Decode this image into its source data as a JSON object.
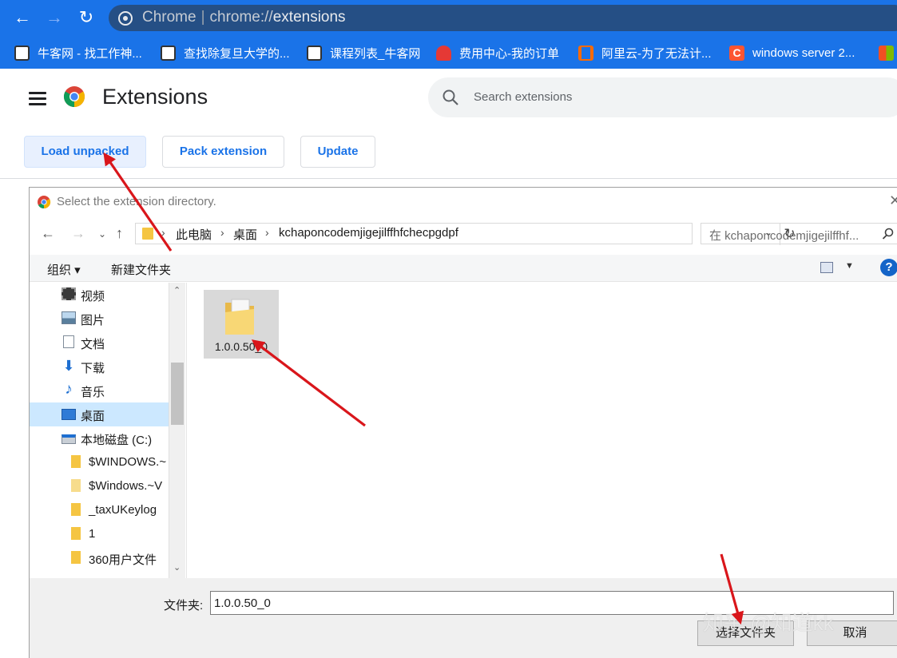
{
  "browser": {
    "omnibox_site": "Chrome",
    "omnibox_separator": "|",
    "omnibox_url_scheme": "chrome://",
    "omnibox_url_host": "extensions",
    "back_glyph": "←",
    "forward_glyph": "→",
    "reload_glyph": "↻"
  },
  "bookmarks": [
    {
      "label": "牛客网 - 找工作神...",
      "icon": "nowcoder-icon",
      "color": "#ffffff"
    },
    {
      "label": "查找除复旦大学的...",
      "icon": "nowcoder-icon",
      "color": "#ffffff"
    },
    {
      "label": "课程列表_牛客网",
      "icon": "nowcoder-icon",
      "color": "#ffffff"
    },
    {
      "label": "费用中心-我的订单",
      "icon": "huawei-icon",
      "color": "#e53935"
    },
    {
      "label": "阿里云-为了无法计...",
      "icon": "aliyun-icon",
      "color": "#ff6a00"
    },
    {
      "label": "windows server 2...",
      "icon": "csdn-icon",
      "color": "#fc5531"
    }
  ],
  "extensions_page": {
    "title": "Extensions",
    "search_placeholder": "Search extensions",
    "buttons": {
      "load_unpacked": "Load unpacked",
      "pack_extension": "Pack extension",
      "update": "Update"
    }
  },
  "dialog": {
    "title": "Select the extension directory.",
    "close_glyph": "✕",
    "breadcrumb": [
      "此电脑",
      "桌面",
      "kchaponcodemjigejilffhfchecpgdpf"
    ],
    "search_placeholder": "在 kchaponcodemjigejilffhf...",
    "commands": {
      "organize": "组织 ▾",
      "new_folder": "新建文件夹"
    },
    "help_glyph": "?",
    "nav_items": [
      {
        "label": "视频",
        "icon": "video-icon"
      },
      {
        "label": "图片",
        "icon": "pictures-icon"
      },
      {
        "label": "文档",
        "icon": "documents-icon"
      },
      {
        "label": "下载",
        "icon": "download-icon"
      },
      {
        "label": "音乐",
        "icon": "music-icon"
      },
      {
        "label": "桌面",
        "icon": "desktop-icon",
        "selected": true
      },
      {
        "label": "本地磁盘 (C:)",
        "icon": "drive-icon"
      },
      {
        "label": "$WINDOWS.~",
        "icon": "folder-icon"
      },
      {
        "label": "$Windows.~V",
        "icon": "folder-icon"
      },
      {
        "label": "_taxUKeylog",
        "icon": "folder-icon"
      },
      {
        "label": "1",
        "icon": "folder-icon"
      },
      {
        "label": "360用户文件",
        "icon": "folder-icon"
      }
    ],
    "files": [
      {
        "name": "1.0.0.50_0",
        "icon": "folder-icon"
      }
    ],
    "footer": {
      "folder_label": "文件夹:",
      "folder_value": "1.0.0.50_0",
      "select_button": "选择文件夹",
      "cancel_button": "取消"
    }
  },
  "watermark": "知乎 @知道kk",
  "colors": {
    "chrome_blue": "#1a73e8",
    "annotation_arrow": "#d9161b"
  }
}
